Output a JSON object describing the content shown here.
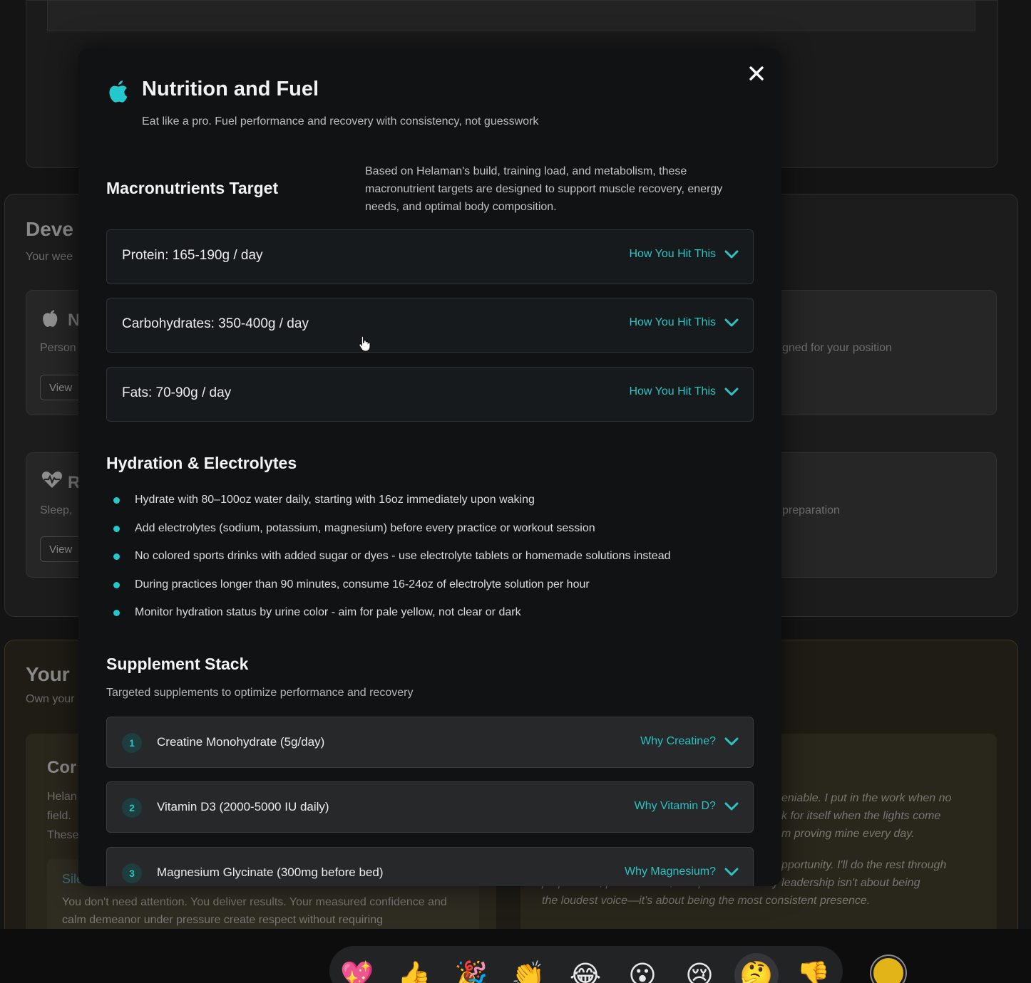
{
  "modal": {
    "title": "Nutrition and Fuel",
    "subtitle": "Eat like a pro. Fuel performance and recovery with consistency, not guesswork",
    "accent_color": "#22c8cc",
    "macros": {
      "title": "Macronutrients Target",
      "description": "Based on Helaman's build, training load, and metabolism, these macronutrient targets are designed to support muscle recovery, energy needs, and optimal body composition.",
      "rows": [
        {
          "label": "Protein: 165-190g / day",
          "toggle": "How You Hit This"
        },
        {
          "label": "Carbohydrates: 350-400g / day",
          "toggle": "How You Hit This"
        },
        {
          "label": "Fats: 70-90g / day",
          "toggle": "How You Hit This"
        }
      ]
    },
    "hydration": {
      "title": "Hydration & Electrolytes",
      "items": [
        "Hydrate with 80–100oz water daily, starting with 16oz immediately upon waking",
        "Add electrolytes (sodium, potassium, magnesium) before every practice or workout session",
        "No colored sports drinks with added sugar or dyes - use electrolyte tablets or homemade solutions instead",
        "During practices longer than 90 minutes, consume 16-24oz of electrolyte solution per hour",
        "Monitor hydration status by urine color - aim for pale yellow, not clear or dark"
      ]
    },
    "supplements": {
      "title": "Supplement Stack",
      "subtitle": "Targeted supplements to optimize performance and recovery",
      "rows": [
        {
          "num": "1",
          "label": "Creatine Monohydrate (5g/day)",
          "toggle": "Why Creatine?"
        },
        {
          "num": "2",
          "label": "Vitamin D3 (2000-5000 IU daily)",
          "toggle": "Why Vitamin D?"
        },
        {
          "num": "3",
          "label": "Magnesium Glycinate (300mg before bed)",
          "toggle": "Why Magnesium?"
        }
      ]
    }
  },
  "background": {
    "dev_title": "Deve",
    "dev_sub": "Your wee",
    "card1": {
      "letter": "N",
      "text": "Person",
      "right_text": "gned for your position",
      "button": "View"
    },
    "card2": {
      "letter": "R",
      "text": "Sleep,",
      "right_text": "preparation",
      "button": "View"
    },
    "your_title": "Your",
    "your_sub": "Own your",
    "core_title": "Cor",
    "core_lines": [
      "Helan",
      "field.",
      "These"
    ],
    "silent_title": "Sile",
    "silent_text": "You don't need attention. You deliver results. Your measured confidence and calm demeanor under pressure create respect without requiring",
    "quote_lines_1": [
      "eniable. I put in the work when no",
      "k for itself when the lights come",
      "m proving mine every day."
    ],
    "quote_lines_2": [
      "pportunity. I'll do the rest through",
      "preparation, performance, and persistence. My leadership isn't about being",
      "the loudest voice—it's about being the most consistent presence."
    ]
  },
  "reactions": [
    {
      "name": "sparkling-heart",
      "glyph": "💖"
    },
    {
      "name": "thumbs-up",
      "glyph": "👍"
    },
    {
      "name": "party-popper",
      "glyph": "🎉"
    },
    {
      "name": "clapping-hands",
      "glyph": "👏"
    },
    {
      "name": "tears-of-joy",
      "glyph": "😂"
    },
    {
      "name": "surprised-face",
      "glyph": "😮"
    },
    {
      "name": "crying-face",
      "glyph": "😢"
    },
    {
      "name": "thinking-face",
      "glyph": "🤔"
    },
    {
      "name": "thumbs-down",
      "glyph": "👎"
    }
  ],
  "active_reaction": "thinking-face"
}
